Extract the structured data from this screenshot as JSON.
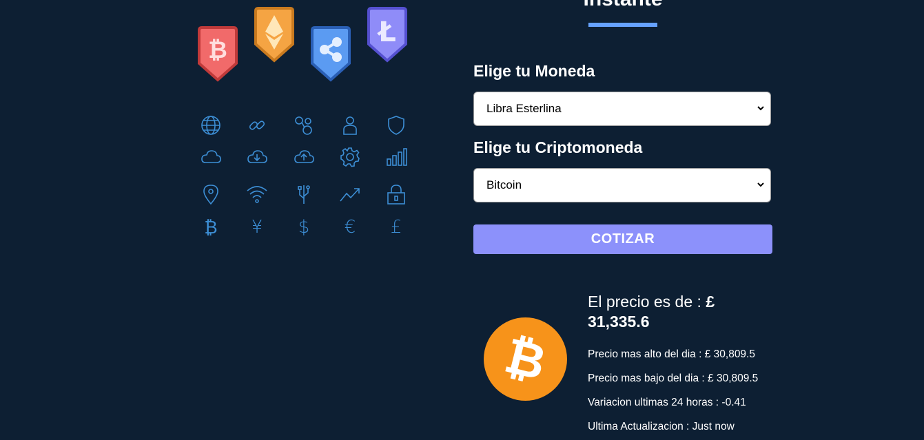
{
  "header": {
    "title_fragment": "Instante"
  },
  "form": {
    "currency_label": "Elige tu Moneda",
    "currency_value": "Libra Esterlina",
    "crypto_label": "Elige tu Criptomoneda",
    "crypto_value": "Bitcoin",
    "submit_label": "COTIZAR"
  },
  "result": {
    "price_prefix": "El precio es de : ",
    "price_value": "£ 31,335.6",
    "high": "Precio mas alto del dia : £ 30,809.5",
    "low": "Precio mas bajo del dia : £ 30,809.5",
    "change": "Variacion ultimas 24 horas : -0.41",
    "updated": "Ultima Actualizacion : Just now"
  },
  "colors": {
    "background": "#0d1f33",
    "accent": "#66a2fe",
    "button": "#8c91fb",
    "icon_blue": "#3d8fd6",
    "bitcoin_orange": "#f7931a"
  },
  "decor": {
    "badges": [
      "bitcoin-badge-icon",
      "ethereum-badge-icon",
      "ripple-badge-icon",
      "litecoin-badge-icon"
    ],
    "icons": [
      "globe-icon",
      "link-icon",
      "nodes-icon",
      "user-icon",
      "shield-icon",
      "cloud-icon",
      "cloud-download-icon",
      "cloud-upload-icon",
      "gear-icon",
      "bar-chart-icon",
      "map-pin-icon",
      "wifi-icon",
      "usb-icon",
      "trend-up-icon",
      "lock-icon",
      "bitcoin-symbol-icon",
      "yen-icon",
      "dollar-icon",
      "euro-icon",
      "pound-icon"
    ],
    "currency_glyphs": [
      "₿",
      "¥",
      "$",
      "€",
      "£"
    ]
  }
}
